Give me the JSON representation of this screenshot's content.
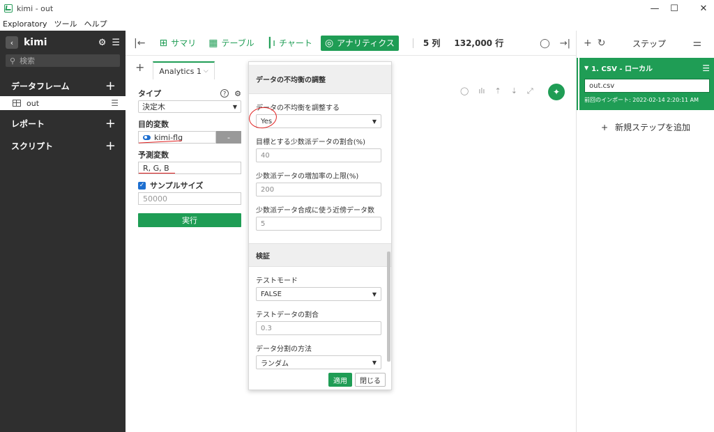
{
  "window": {
    "title": "kimi - out",
    "min": "—",
    "max": "☐",
    "close": "✕"
  },
  "menu": [
    "Exploratory",
    "ツール",
    "ヘルプ"
  ],
  "sidebar": {
    "project": "kimi",
    "search_placeholder": "検索",
    "dataframes_label": "データフレーム",
    "dataframe_item": "out",
    "reports_label": "レポート",
    "scripts_label": "スクリプト"
  },
  "toolbar": {
    "summary": "サマリ",
    "table": "テーブル",
    "chart": "チャート",
    "analytics": "アナリティクス",
    "columns": "5 列",
    "rows": "132,000 行"
  },
  "tabs": {
    "active": "Analytics 1"
  },
  "form": {
    "type_label": "タイプ",
    "type_value": "決定木",
    "target_label": "目的変数",
    "target_value": "kimi-flg",
    "target_remove": "-",
    "predictor_label": "予測変数",
    "predictor_value": "R, G, B",
    "sample_label": "サンプルサイズ",
    "sample_value": "50000",
    "run_button": "実行"
  },
  "popup": {
    "header": "データの不均衡の調整",
    "adjust_label": "データの不均衡を調整する",
    "adjust_value": "Yes",
    "target_ratio_label": "目標とする少数派データの割合(%)",
    "target_ratio_value": "40",
    "max_increase_label": "少数派データの増加率の上限(%)",
    "max_increase_value": "200",
    "neighbors_label": "少数派データ合成に使う近傍データ数",
    "neighbors_value": "5",
    "validation_header": "検証",
    "test_mode_label": "テストモード",
    "test_mode_value": "FALSE",
    "test_ratio_label": "テストデータの割合",
    "test_ratio_value": "0.3",
    "split_label": "データ分割の方法",
    "split_value": "ランダム",
    "apply_button": "適用",
    "close_button": "閉じる"
  },
  "steps": {
    "title": "ステップ",
    "step1_title": "1. CSV - ローカル",
    "step1_file": "out.csv",
    "step1_import": "前回のインポート: 2022-02-14 2:20:11 AM",
    "add_step": "新規ステップを追加"
  },
  "colors": {
    "accent": "#1f9d55",
    "sidebar": "#2f2f2f",
    "annotation": "#e02020"
  }
}
